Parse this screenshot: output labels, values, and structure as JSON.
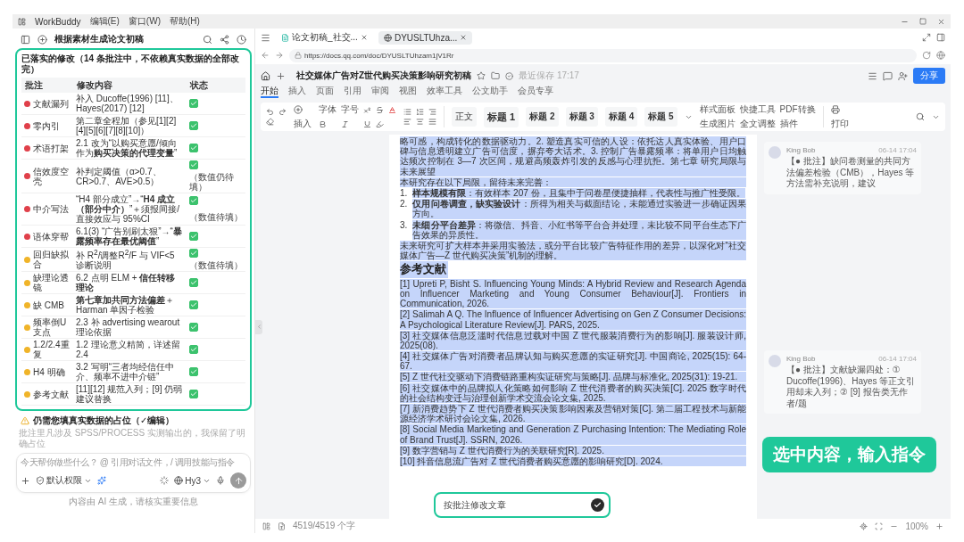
{
  "app": {
    "name": "WorkBuddy",
    "menus": [
      "编辑(E)",
      "窗口(W)",
      "帮助(H)"
    ]
  },
  "left": {
    "title": "根据素材生成论文初稿",
    "card": {
      "title": "已落实的修改（14 条批注中，不依赖真实数据的全部改完）",
      "columns": [
        "批注",
        "修改内容",
        "状态"
      ],
      "rows": [
        {
          "label": "文献漏列",
          "color": "#e0404a",
          "change": "补入 Ducoffe(1996) [11]、Hayes(2017) [12]",
          "done": true
        },
        {
          "label": "零内引",
          "color": "#e0404a",
          "change": "第二章全程加（参见[1][2][4][5][6][7][8][10]）",
          "done": true
        },
        {
          "label": "术语打架",
          "color": "#e0404a",
          "change": "2.1 改为“以购买意愿/倾向作为**购买决策的代理变量**”",
          "done": true
        },
        {
          "label": "信效度空壳",
          "color": "#e0404a",
          "change": "补判定阈值（α>0.7、CR>0.7、AVE>0.5）",
          "done": true,
          "note": "（数值仍待填）"
        },
        {
          "label": "中介写法",
          "color": "#e0404a",
          "change": "“H4 部分成立”→“**H4 成立（部分中介）**”＋须报间接/直接效应与 95%CI",
          "done": true,
          "note": "（数值待填）"
        },
        {
          "label": "语体穿帮",
          "color": "#e0404a",
          "change": "6.1(3) “广告别刷太狠”→“**暴露频率存在最优阈值**”",
          "done": true
        },
        {
          "label": "回归缺拟合",
          "color": "#f0b429",
          "change": "补 R$^{2}$/调整R$^{2}$/F 与 VIF<5 诊断说明",
          "done": true,
          "note": "（数值待填）"
        },
        {
          "label": "缺理论透镜",
          "color": "#f0b429",
          "change": "6.2 点明 ELM + **信任转移理论**",
          "done": true
        },
        {
          "label": "缺 CMB",
          "color": "#f0b429",
          "change": "**第七章加共同方法偏差**＋Harman 单因子检验",
          "done": true
        },
        {
          "label": "频率倒U支点",
          "color": "#f0b429",
          "change": "2.3 补 advertising wearout 理论依据",
          "done": true
        },
        {
          "label": "1.2/2.4重复",
          "color": "#f0b429",
          "change": "1.2 理论意义精简，详述留 2.4",
          "done": true
        },
        {
          "label": "H4 明确",
          "color": "#f0b429",
          "change": "3.2 写明“三者均经信任中介、频率不进中介链”",
          "done": true
        },
        {
          "label": "参考文献",
          "color": "#f0b429",
          "change": "[11][12] 规范入列；[9] 仍弱建议替换",
          "done": true
        }
      ]
    },
    "warning": {
      "title": "仍需您填真实数据的占位（✓编辑）",
      "hint": "批注里凡涉及 SPSS/PROCESS 实测输出的，我保留了明确占位"
    },
    "composer": {
      "placeholder": "今天帮你做些什么？ @ 引用对话文件，/ 调用技能与指令",
      "permission": "默认权限",
      "model": "Hy3"
    },
    "disclaimer": "内容由 AI 生成，请核实重要信息"
  },
  "browser": {
    "tabs": [
      {
        "label": "论文初稿_社交...",
        "selected": false,
        "kind": "doc"
      },
      {
        "label": "DYUSLTUhza...",
        "selected": true,
        "kind": "web"
      }
    ],
    "url": "https://docs.qq.com/doc/DYUSLTUhzam1jV1Rr"
  },
  "doc": {
    "title": "社交媒体广告对Z世代购买决策影响研究初稿",
    "save_status": "最近保存 17:17",
    "share": "分享",
    "menu": [
      {
        "label": "开始",
        "selected": true
      },
      {
        "label": "插入",
        "selected": false
      },
      {
        "label": "页面",
        "selected": false
      },
      {
        "label": "引用",
        "selected": false
      },
      {
        "label": "审阅",
        "selected": false
      },
      {
        "label": "视图",
        "selected": false
      },
      {
        "label": "效率工具",
        "selected": false
      },
      {
        "label": "公文助手",
        "selected": false
      },
      {
        "label": "会员专享",
        "selected": false
      }
    ],
    "toolbar": {
      "insert": "插入",
      "font": "字体",
      "size": "字号",
      "styles": [
        {
          "label": "正文",
          "kind": "body"
        },
        {
          "label": "标题 1",
          "kind": "h1"
        },
        {
          "label": "标题 2",
          "kind": "h2"
        },
        {
          "label": "标题 3",
          "kind": "h3"
        },
        {
          "label": "标题 4",
          "kind": "h4"
        },
        {
          "label": "标题 5",
          "kind": "h5"
        }
      ],
      "tools": [
        "样式面板",
        "生成图片",
        "快捷工具",
        "全文调整",
        "PDF转换",
        "插件"
      ],
      "print": "打印"
    },
    "body": [
      {
        "kind": "para",
        "text": "略可感，构成转化的数据驱动力。2. 塑造真实可信的人设：依托达人真实体验、用户口碑与信息透明建立广告可信度，摒弃夸大话术。3. 控制广告暴露频率：将单用户日均触达频次控制在 3—7 次区间，规避高频轰炸引发的反感与心理抗拒。第七章 研究局限与未来展望"
      },
      {
        "kind": "para",
        "text": "本研究存在以下局限，留待未来完善："
      },
      {
        "kind": "list",
        "items": [
          {
            "num": "1.",
            "text": "**样本规模有限**：有效样本 207 份，且集中于问卷星便捷抽样，代表性与推广性受限。"
          },
          {
            "num": "2.",
            "text": "**仅用问卷调查，缺实验设计**：所得为相关与截面结论，未能通过实验进一步确证因果方向。"
          },
          {
            "num": "3.",
            "text": "**未细分平台差异**：将微信、抖音、小红书等平台合并处理，未比较不同平台生态下广告效果的异质性。"
          }
        ]
      },
      {
        "kind": "para",
        "text": "未来研究可扩大样本并采用实验法，或分平台比较广告特征作用的差异，以深化对“社交媒体广告—Z 世代购买决策”机制的理解。"
      },
      {
        "kind": "heading",
        "text": "参考文献"
      },
      {
        "kind": "ref",
        "text": "[1] Upreti P, Bisht S. Influencing Young Minds: A Hybrid Review and Research Agenda on Influencer Marketing and Young Consumer Behaviour[J]. Frontiers in Communication, 2026."
      },
      {
        "kind": "ref",
        "text": "[2] Salimah A Q. The Influence of Influencer Advertising on Gen Z Consumer Decisions: A Psychological Literature Review[J]. PARS, 2025."
      },
      {
        "kind": "ref",
        "text": "[3] 社交媒体信息泛滥时代信息过载对中国 Z 世代服装消费行为的影响[J]. 服装设计师, 2025(08)."
      },
      {
        "kind": "ref",
        "text": "[4] 社交媒体广告对消费者品牌认知与购买意愿的实证研究[J]. 中国商论, 2025(15): 64-67."
      },
      {
        "kind": "ref",
        "text": "[5] Z 世代社交驱动下消费链路重构实证研究与策略[J]. 品牌与标准化, 2025(31): 19-21."
      },
      {
        "kind": "ref",
        "text": "[6] 社交媒体中的品牌拟人化策略如何影响 Z 世代消费者的购买决策[C]. 2025 数字时代的社会结构变迁与治理创新学术交流会论文集, 2025."
      },
      {
        "kind": "ref",
        "text": "[7] 新消费趋势下 Z 世代消费者购买决策影响因素及营销对策[C]. 第二届工程技术与新能源经济学术研讨会论文集, 2026."
      },
      {
        "kind": "ref",
        "text": "[8] Social Media Marketing and Generation Z Purchasing Intention: The Mediating Role of Brand Trust[J]. SSRN, 2026."
      },
      {
        "kind": "ref",
        "text": "[9] 数字营销与 Z 世代消费行为的关联研究[R]. 2025."
      },
      {
        "kind": "ref",
        "text": "[10] 抖音信息流广告对 Z 世代消费者购买意愿的影响研究[D]. 2024."
      }
    ],
    "comments": [
      {
        "author": "King Bob",
        "time": "06-14 17:04",
        "text": "【● 批注】缺问卷测量的共同方法偏差检验（CMB），Hayes 等方法需补充说明，建议"
      },
      {
        "author": "King Bob",
        "time": "06-14 17:04",
        "text": "【● 批注】文献缺漏四处：① Ducoffe(1996)、Hayes 等正文引用却未入列；② [9] 报告类无作者/题"
      }
    ],
    "banner": "选中内容，输入指令",
    "command": {
      "value": "按批注修改文章"
    },
    "status": {
      "word_count": "4519/4519 个字",
      "zoom": "100%"
    }
  }
}
